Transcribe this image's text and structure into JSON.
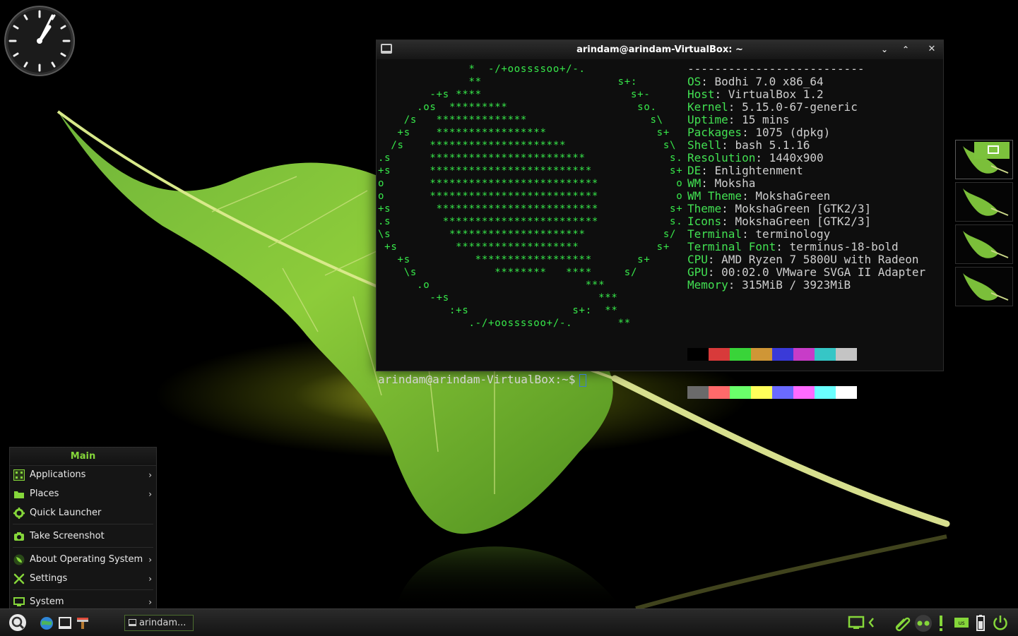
{
  "terminal": {
    "title": "arindam@arindam-VirtualBox: ~",
    "buttons": {
      "minimize": "⌄",
      "maximize": "⌃",
      "close": "✕"
    },
    "ascii_art": [
      "              *  -/+oossssoo+/-.",
      "              **                     s+:",
      "        -+s ****                       s+-",
      "      .os  *********                    so.",
      "    /s   **************                   s\\",
      "   +s    *****************                 s+",
      "  /s    *********************               s\\",
      ".s      ************************             s.",
      "+s      *************************            s+",
      "o       **************************            o",
      "o       **************************            o",
      "+s       *************************           s+",
      ".s        ************************           s.",
      "\\s         *********************            s/",
      " +s         *******************            s+",
      "   +s          ******************       s+",
      "    \\s            ********   ****     s/",
      "      .o                        ***",
      "        -+s                       ***",
      "           :+s                s+:  **",
      "              .-/+oossssoo+/-.       **"
    ],
    "info": [
      {
        "key": "",
        "value": "--------------------------"
      },
      {
        "key": "OS",
        "value": "Bodhi 7.0 x86_64"
      },
      {
        "key": "Host",
        "value": "VirtualBox 1.2"
      },
      {
        "key": "Kernel",
        "value": "5.15.0-67-generic"
      },
      {
        "key": "Uptime",
        "value": "15 mins"
      },
      {
        "key": "Packages",
        "value": "1075 (dpkg)"
      },
      {
        "key": "Shell",
        "value": "bash 5.1.16"
      },
      {
        "key": "Resolution",
        "value": "1440x900"
      },
      {
        "key": "DE",
        "value": "Enlightenment"
      },
      {
        "key": "WM",
        "value": "Moksha"
      },
      {
        "key": "WM Theme",
        "value": "MokshaGreen"
      },
      {
        "key": "Theme",
        "value": "MokshaGreen [GTK2/3]"
      },
      {
        "key": "Icons",
        "value": "MokshaGreen [GTK2/3]"
      },
      {
        "key": "Terminal",
        "value": "terminology"
      },
      {
        "key": "Terminal Font",
        "value": "terminus-18-bold"
      },
      {
        "key": "CPU",
        "value": "AMD Ryzen 7 5800U with Radeon"
      },
      {
        "key": "GPU",
        "value": "00:02.0 VMware SVGA II Adapter"
      },
      {
        "key": "Memory",
        "value": "315MiB / 3923MiB"
      }
    ],
    "palette_row1": [
      "#000000",
      "#d83a3a",
      "#39d439",
      "#cf9636",
      "#3a3ad8",
      "#c83cc8",
      "#36c6c6",
      "#c4c4c4"
    ],
    "palette_row2": [
      "#6a6a6a",
      "#ff6a6a",
      "#6aff6a",
      "#ffff5a",
      "#6a6aff",
      "#ff6aff",
      "#6affff",
      "#ffffff"
    ],
    "prompt": "arindam@arindam-VirtualBox:~$"
  },
  "menu": {
    "title": "Main",
    "items": [
      {
        "label": "Applications",
        "icon": "applications-grid-icon",
        "submenu": true
      },
      {
        "label": "Places",
        "icon": "places-icon",
        "submenu": true
      },
      {
        "label": "Quick Launcher",
        "icon": "gear-icon",
        "submenu": false
      },
      {
        "label": "Take Screenshot",
        "icon": "camera-icon",
        "submenu": false
      },
      {
        "label": "About Operating System",
        "icon": "bodhi-leaf-icon",
        "submenu": true
      },
      {
        "label": "Settings",
        "icon": "tools-icon",
        "submenu": true
      },
      {
        "label": "System",
        "icon": "monitor-icon",
        "submenu": true
      }
    ],
    "arrow": "›"
  },
  "taskbar": {
    "task_label": "arindam...",
    "launchers": [
      "menu-search-icon",
      "web-browser-icon",
      "terminal-icon",
      "file-manager-icon"
    ],
    "tray": [
      "desktop-icon",
      "chevron-left-icon",
      "attachment-icon",
      "eyes-icon",
      "alert-icon",
      "keyboard-layout-icon",
      "battery-icon",
      "power-icon"
    ],
    "keyboard_layout": "us"
  },
  "clock": {
    "hours": 2,
    "minutes": 7
  },
  "colors": {
    "accent": "#85d63a",
    "terminal_green": "#37e84a",
    "terminal_bg": "#0e0e0e"
  }
}
